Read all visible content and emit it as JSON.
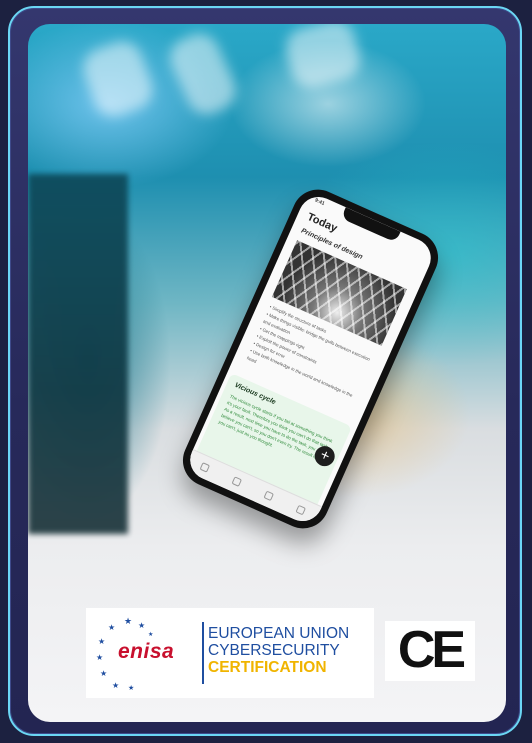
{
  "phone_screen": {
    "time": "9:41",
    "title": "Today",
    "section_title": "Principles of design",
    "bullets": [
      "Simplify the structure of tasks",
      "Make things visible: bridge the gulfs between execution and evaluation",
      "Get the mappings right",
      "Exploit the power of constraints",
      "Design for error",
      "Use both knowledge in the world and knowledge in the head"
    ],
    "card_title": "Vicious cycle",
    "card_text": "The vicious cycle starts if you fail at something you think it's your fault. Therefore you think you can't do that task. As a result, next time you have to do the task, you believe you can't, so you don't even try. The result is that you can't, just as you thought.",
    "fab_label": "+"
  },
  "certification": {
    "logo_text": "enisa",
    "line1": "EUROPEAN UNION",
    "line2": "CYBERSECURITY",
    "line3": "CERTIFICATION",
    "ce_mark": "CE"
  },
  "colors": {
    "frame_border": "#6bd7f4",
    "frame_bg": "#2c2f66",
    "enisa_red": "#c8102e",
    "eu_blue": "#1f4ea0",
    "cert_yellow": "#f0b400"
  }
}
